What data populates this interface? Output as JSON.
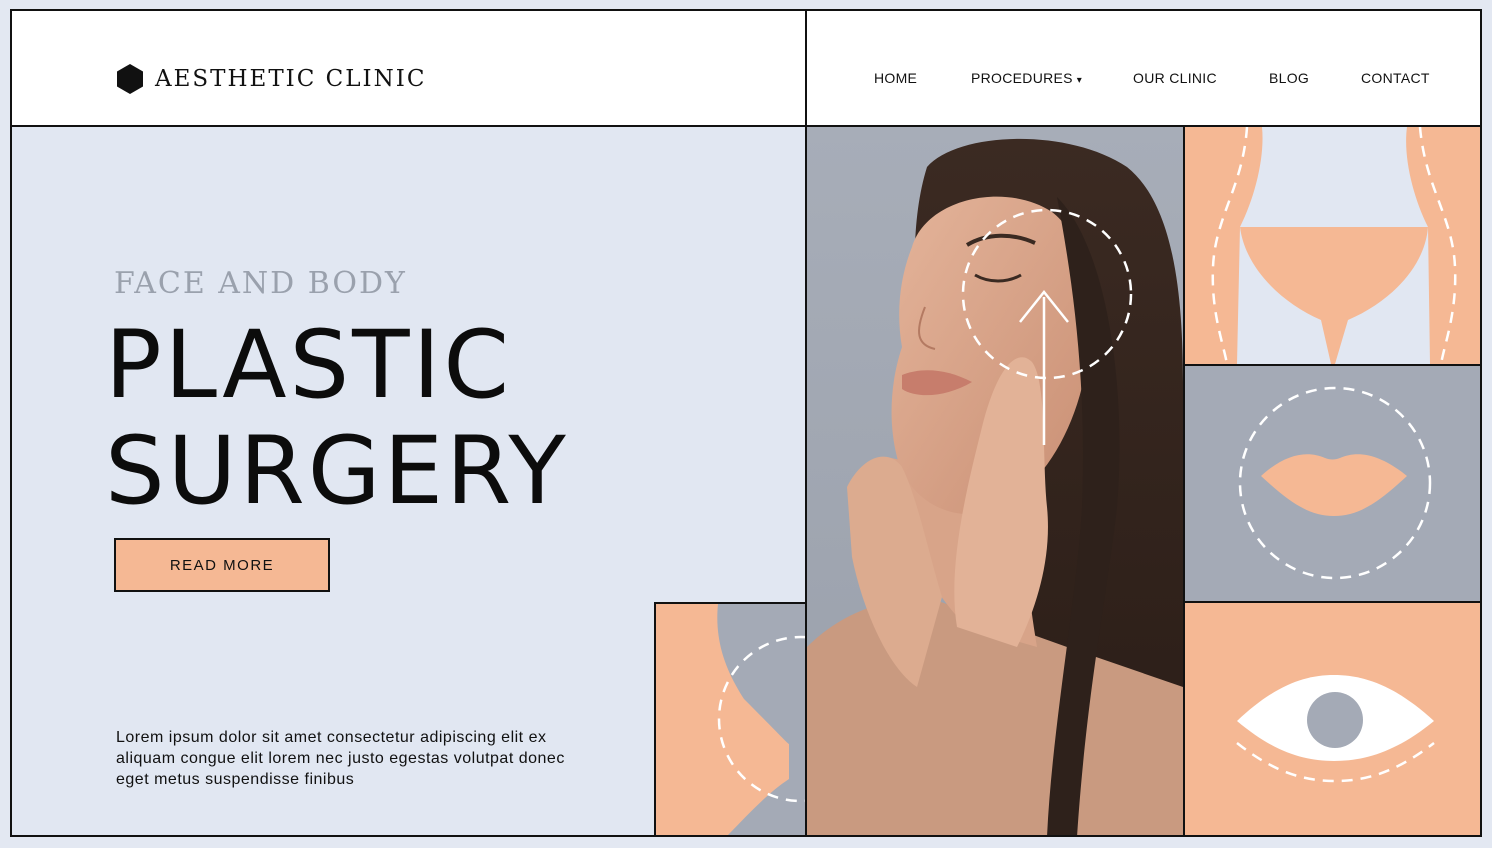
{
  "brand": {
    "name": "AESTHETIC CLINIC",
    "logo_icon": "hexagon-icon"
  },
  "nav": {
    "items": [
      "HOME",
      "PROCEDURES",
      "OUR CLINIC",
      "BLOG",
      "CONTACT"
    ],
    "dropdown_caret": "▾"
  },
  "hero": {
    "eyebrow": "FACE AND BODY",
    "title_line1": "PLASTIC",
    "title_line2": "SURGERY",
    "cta_label": "READ MORE",
    "body_text": "Lorem ipsum dolor sit amet consectetur adipiscing elit ex aliquam congue elit lorem nec justo egestas volutpat donec eget metus suspendisse finibus"
  },
  "colors": {
    "peach": "#f5b894",
    "slate": "#a4aab6",
    "pale_blue": "#e1e7f2",
    "ink": "#111111"
  },
  "icons": [
    "body-contour-icon",
    "lips-icon",
    "eye-icon",
    "breast-contour-icon",
    "face-lift-arrow-icon"
  ]
}
